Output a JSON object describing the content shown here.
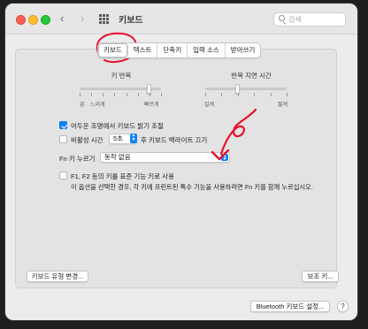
{
  "window": {
    "title": "키보드"
  },
  "search": {
    "placeholder": "검색"
  },
  "tabs": [
    {
      "label": "키보드",
      "selected": true
    },
    {
      "label": "텍스트"
    },
    {
      "label": "단축키"
    },
    {
      "label": "입력 소스"
    },
    {
      "label": "받아쓰기"
    }
  ],
  "key_repeat": {
    "label": "키 반복",
    "min_label": "끔",
    "slow_label": "느리게",
    "fast_label": "빠르게",
    "level": 0.85
  },
  "repeat_delay": {
    "label": "반복 지연 시간",
    "long_label": "길게",
    "short_label": "짧게",
    "level": 0.4
  },
  "options": {
    "adjust_brightness": {
      "label": "어두운 조명에서 키보드 밝기 조절",
      "checked": true
    },
    "backlight_off": {
      "label_prefix": "비활성 시간",
      "value": "5초",
      "label_suffix": "후 키보드 백라이트 끄기",
      "checked": false
    },
    "fn_key": {
      "label": "Fn 키 누르기",
      "value": "동작 없음"
    },
    "function_keys": {
      "label": "F1, F2 등의 키를 표준 기능 키로 사용",
      "description": "이 옵션을 선택한 경우, 각 키에 프린트된 특수 기능을 사용하려면 Fn 키를 함께 누르십시오.",
      "checked": false
    }
  },
  "buttons": {
    "change_keyboard_type": "키보드 유형 변경...",
    "modifier_keys": "보조 키...",
    "bluetooth_setup": "Bluetooth 키보드 설정...",
    "help": "?"
  },
  "colors": {
    "accent": "#0a84ff",
    "annotation": "#e8102a"
  },
  "icons": {
    "back": "chevron-left-icon",
    "forward": "chevron-right-icon",
    "grid": "show-all-grid-icon",
    "search": "search-icon"
  }
}
